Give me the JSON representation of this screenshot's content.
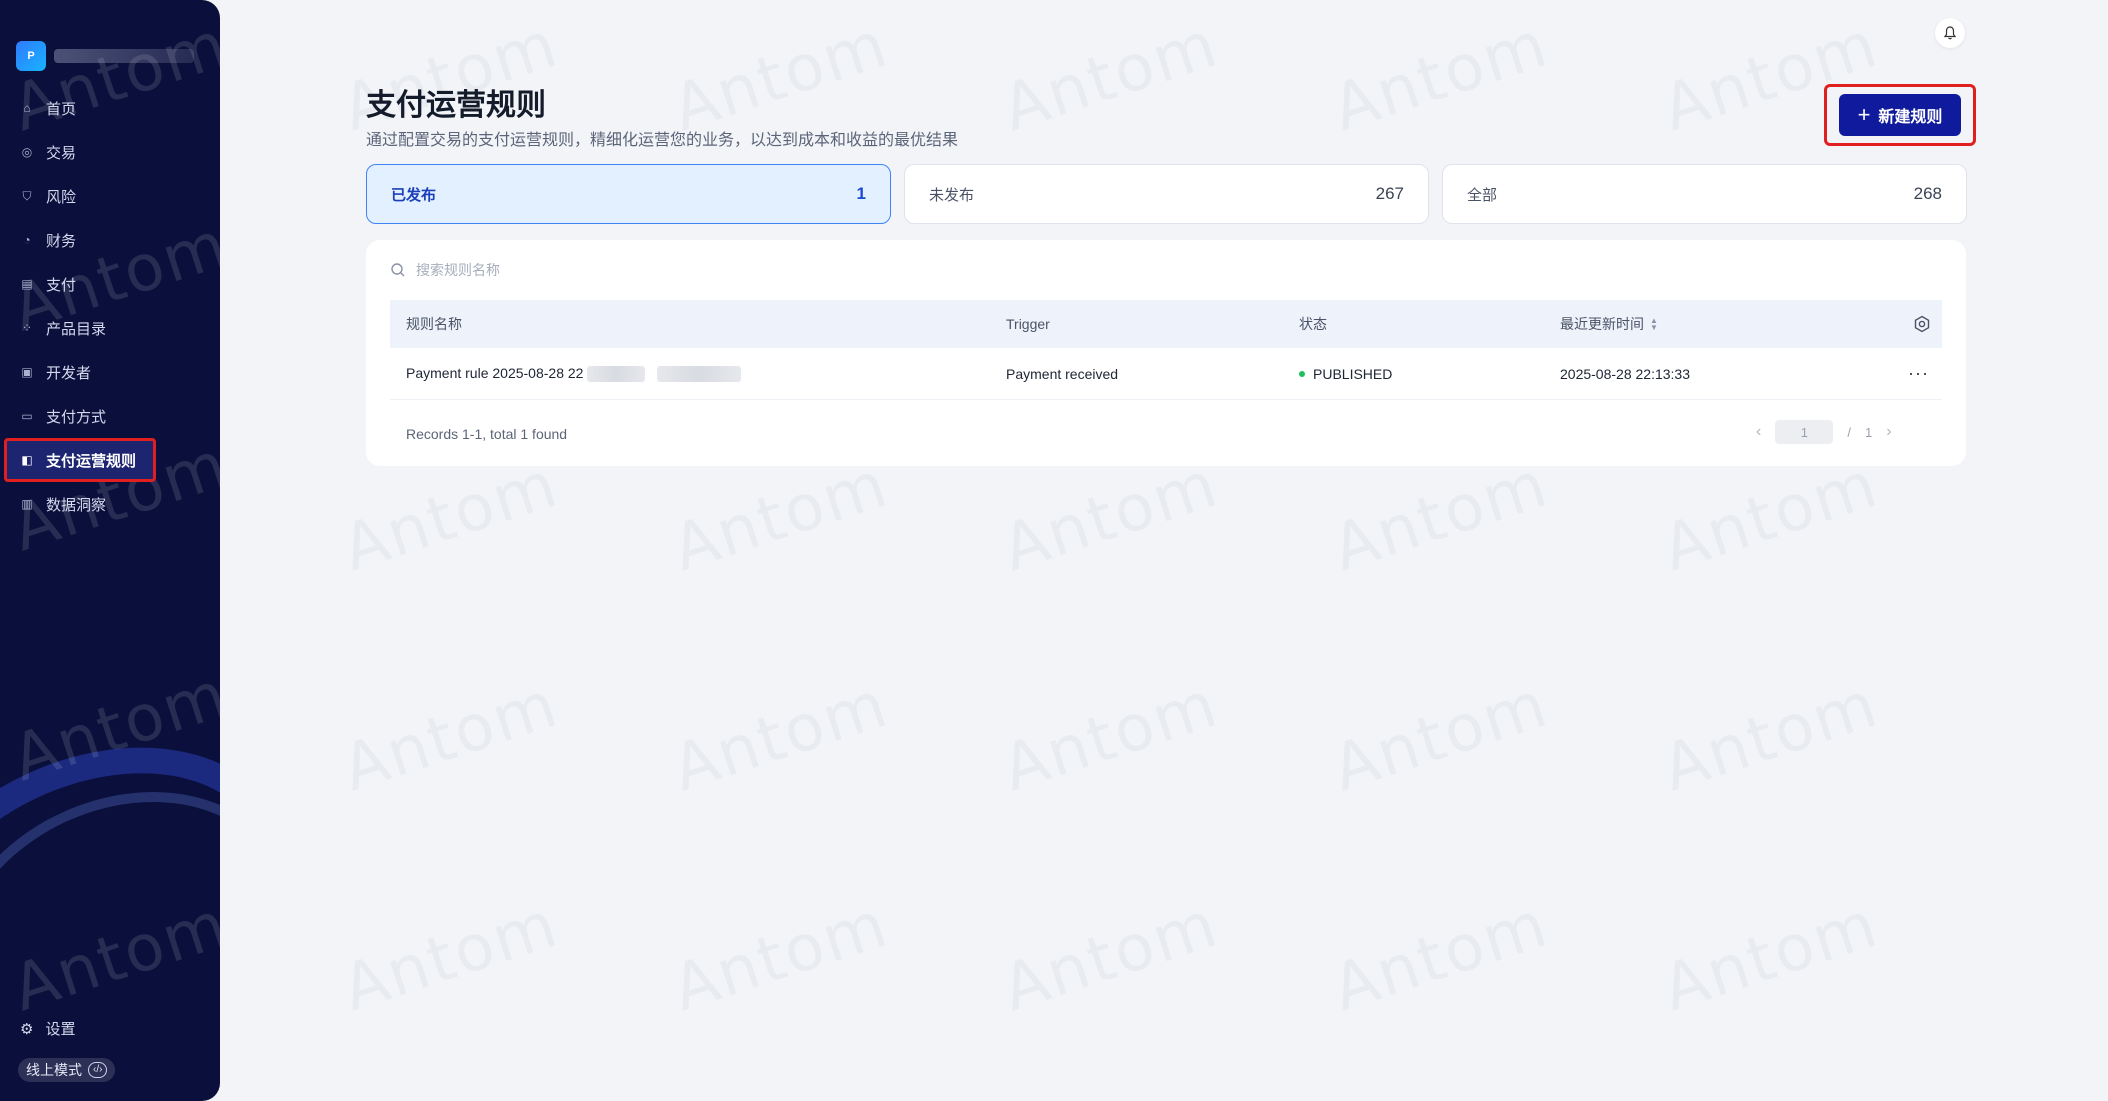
{
  "sidebar": {
    "account_logo_letter": "P",
    "items": [
      {
        "label": "首页",
        "icon": "home-icon",
        "glyph": "⌂"
      },
      {
        "label": "交易",
        "icon": "transaction-icon",
        "glyph": "◎"
      },
      {
        "label": "风险",
        "icon": "shield-icon",
        "glyph": "⛉"
      },
      {
        "label": "财务",
        "icon": "finance-icon",
        "glyph": "◔"
      },
      {
        "label": "支付",
        "icon": "payment-icon",
        "glyph": "▤"
      },
      {
        "label": "产品目录",
        "icon": "catalog-icon",
        "glyph": "⁘"
      },
      {
        "label": "开发者",
        "icon": "developer-icon",
        "glyph": "▣"
      },
      {
        "label": "支付方式",
        "icon": "payment-method-icon",
        "glyph": "▭"
      },
      {
        "label": "支付运营规则",
        "icon": "payment-rule-icon",
        "glyph": "◧",
        "active": true
      },
      {
        "label": "数据洞察",
        "icon": "data-insight-icon",
        "glyph": "▥"
      }
    ],
    "settings_label": "设置",
    "mode_label": "线上模式",
    "mode_code_glyph": "‹/›"
  },
  "header": {
    "title": "支付运营规则",
    "description": "通过配置交易的支付运营规则，精细化运营您的业务，以达到成本和收益的最优结果",
    "new_rule_label": "新建规则"
  },
  "tabs": [
    {
      "label": "已发布",
      "count": "1",
      "active": true
    },
    {
      "label": "未发布",
      "count": "267"
    },
    {
      "label": "全部",
      "count": "268"
    }
  ],
  "search": {
    "placeholder": "搜索规则名称"
  },
  "table": {
    "columns": [
      "规则名称",
      "Trigger",
      "状态",
      "最近更新时间"
    ],
    "rows": [
      {
        "name_prefix": "Payment rule 2025-08-28 22",
        "trigger": "Payment received",
        "status": "PUBLISHED",
        "updated": "2025-08-28 22:13:33",
        "more": "···"
      }
    ]
  },
  "footer": {
    "records": "Records 1-1, total 1 found",
    "page": "1",
    "separator": "/",
    "total_pages": "1"
  },
  "watermark": "Antom",
  "colors": {
    "sidebar_bg": "#0a0f3b",
    "primary_button": "#101a9c",
    "highlight_outline": "#e0201e",
    "active_tab_bg": "#e3f0ff",
    "status_published": "#1fbf60"
  }
}
